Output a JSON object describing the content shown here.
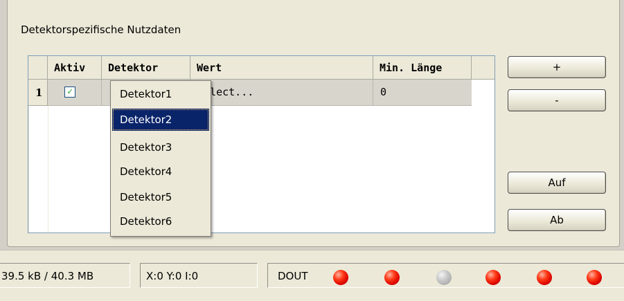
{
  "group": {
    "title": "Detektorspezifische Nutzdaten"
  },
  "grid": {
    "columns": [
      "Aktiv",
      "Detektor",
      "Wert",
      "Min. Länge"
    ],
    "rows": [
      {
        "index": "1",
        "aktiv": true,
        "aktiv_mark": "✓",
        "detektor": "",
        "wert": "Select...",
        "min_laenge": "0"
      }
    ]
  },
  "dropdown": {
    "options": [
      "Detektor1",
      "Detektor2",
      "Detektor3",
      "Detektor4",
      "Detektor5",
      "Detektor6"
    ],
    "selected": "Detektor2"
  },
  "buttons": {
    "add": "+",
    "remove": "-",
    "up": "Auf",
    "down": "Ab"
  },
  "status": {
    "memory": "39.5 kB / 40.3 MB",
    "coords": "X:0 Y:0 I:0",
    "dout_label": "DOUT",
    "leds": [
      "red",
      "red",
      "grey",
      "red",
      "red",
      "red"
    ]
  },
  "colors": {
    "led_on": "#e00000",
    "led_off": "#b0b0b0",
    "selection": "#0a246a"
  }
}
